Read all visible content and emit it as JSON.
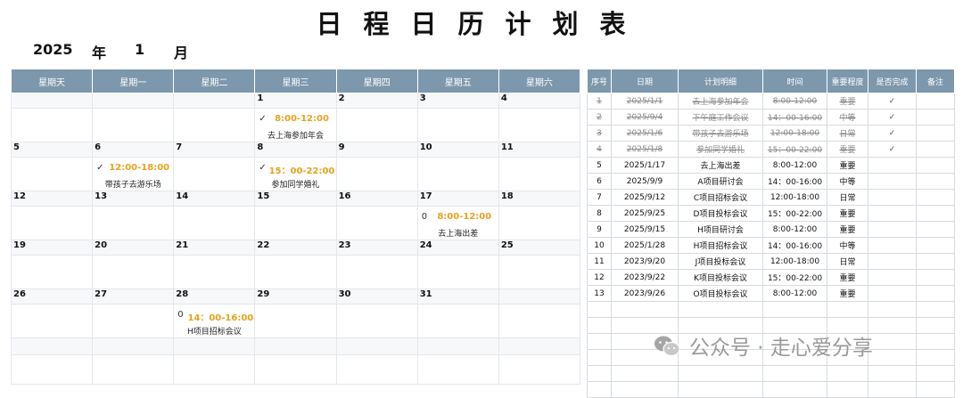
{
  "title": "日程日历计划表",
  "year": "2025",
  "year_unit": "年",
  "month": "1",
  "month_unit": "月",
  "calendar": {
    "weekdays": [
      "星期天",
      "星期一",
      "星期二",
      "星期三",
      "星期四",
      "星期五",
      "星期六"
    ],
    "weeks": [
      {
        "dates": [
          "",
          "",
          "",
          "1",
          "2",
          "3",
          "4"
        ],
        "events": [
          null,
          null,
          null,
          {
            "mark": "✓",
            "time": "8:00-12:00",
            "desc": "去上海参加年会"
          },
          null,
          null,
          null
        ]
      },
      {
        "dates": [
          "5",
          "6",
          "7",
          "8",
          "9",
          "10",
          "11"
        ],
        "events": [
          null,
          {
            "mark": "✓",
            "time": "12:00-18:00",
            "desc": "带孩子去游乐场"
          },
          null,
          {
            "mark": "✓",
            "time": "15：00-22:00",
            "desc": "参加同学婚礼"
          },
          null,
          null,
          null
        ]
      },
      {
        "dates": [
          "12",
          "13",
          "14",
          "15",
          "16",
          "17",
          "18"
        ],
        "events": [
          null,
          null,
          null,
          null,
          null,
          {
            "mark": "0",
            "time": "8:00-12:00",
            "desc": "去上海出差"
          },
          null
        ]
      },
      {
        "dates": [
          "19",
          "20",
          "21",
          "22",
          "23",
          "24",
          "25"
        ],
        "events": [
          null,
          null,
          null,
          null,
          null,
          null,
          null
        ]
      },
      {
        "dates": [
          "26",
          "27",
          "28",
          "29",
          "30",
          "31",
          ""
        ],
        "events": [
          null,
          null,
          {
            "mark": "0",
            "time": "14：00-16:00",
            "desc": "H项目招标会议"
          },
          null,
          null,
          null,
          null
        ]
      }
    ]
  },
  "schedule": {
    "headers": [
      "序号",
      "日期",
      "计划明细",
      "时间",
      "重要程度",
      "是否完成",
      "备注"
    ],
    "rows": [
      {
        "no": "1",
        "date": "2025/1/1",
        "detail": "去上海参加年会",
        "time": "8:00-12:00",
        "priority": "重要",
        "done": "✓",
        "note": "",
        "completed": true
      },
      {
        "no": "2",
        "date": "2025/9/4",
        "detail": "下午庭工作会议",
        "time": "14：00-16:00",
        "priority": "中等",
        "done": "✓",
        "note": "",
        "completed": true
      },
      {
        "no": "3",
        "date": "2025/1/6",
        "detail": "带孩子去游乐场",
        "time": "12:00-18:00",
        "priority": "日常",
        "done": "✓",
        "note": "",
        "completed": true
      },
      {
        "no": "4",
        "date": "2025/1/8",
        "detail": "参加同学婚礼",
        "time": "15：00-22:00",
        "priority": "重要",
        "done": "✓",
        "note": "",
        "completed": true
      },
      {
        "no": "5",
        "date": "2025/1/17",
        "detail": "去上海出差",
        "time": "8:00-12:00",
        "priority": "重要",
        "done": "",
        "note": "",
        "completed": false
      },
      {
        "no": "6",
        "date": "2025/9/9",
        "detail": "A项目研讨会",
        "time": "14：00-16:00",
        "priority": "中等",
        "done": "",
        "note": "",
        "completed": false
      },
      {
        "no": "7",
        "date": "2025/9/12",
        "detail": "C项目招标会议",
        "time": "12:00-18:00",
        "priority": "日常",
        "done": "",
        "note": "",
        "completed": false
      },
      {
        "no": "8",
        "date": "2025/9/25",
        "detail": "D项目投标会议",
        "time": "15：00-22:00",
        "priority": "重要",
        "done": "",
        "note": "",
        "completed": false
      },
      {
        "no": "9",
        "date": "2025/9/15",
        "detail": "H项目研讨会",
        "time": "8:00-12:00",
        "priority": "重要",
        "done": "",
        "note": "",
        "completed": false
      },
      {
        "no": "10",
        "date": "2025/1/28",
        "detail": "H项目招标会议",
        "time": "14：00-16:00",
        "priority": "中等",
        "done": "",
        "note": "",
        "completed": false
      },
      {
        "no": "11",
        "date": "2023/9/20",
        "detail": "J项目投标会议",
        "time": "12:00-18:00",
        "priority": "日常",
        "done": "",
        "note": "",
        "completed": false
      },
      {
        "no": "12",
        "date": "2023/9/22",
        "detail": "K项目投标会议",
        "time": "15：00-22:00",
        "priority": "重要",
        "done": "",
        "note": "",
        "completed": false
      },
      {
        "no": "13",
        "date": "2023/9/26",
        "detail": "O项目投标会议",
        "time": "8:00-12:00",
        "priority": "重要",
        "done": "",
        "note": "",
        "completed": false
      }
    ],
    "empty_rows": 6
  },
  "watermark": "公众号 · 走心爱分享",
  "colors": {
    "header_bg": "#7d98ad",
    "time_text": "#e6a21e",
    "grid": "#e3e8ec"
  }
}
